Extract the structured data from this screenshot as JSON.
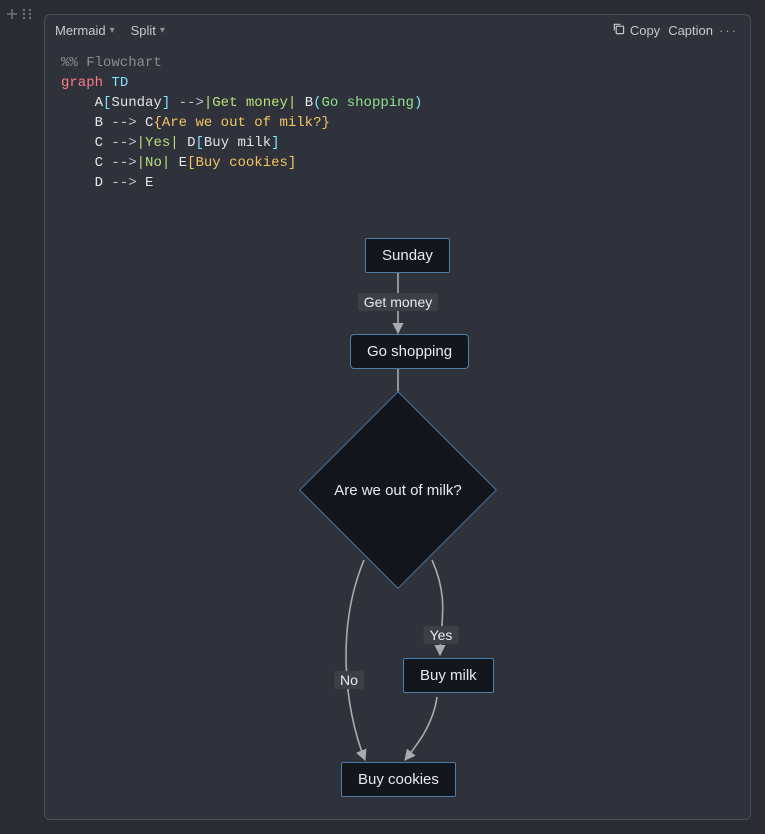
{
  "toolbar": {
    "lang_label": "Mermaid",
    "view_label": "Split",
    "copy_label": "Copy",
    "caption_label": "Caption",
    "more_label": "···"
  },
  "code": {
    "comment": "%% Flowchart",
    "graph_kw": "graph",
    "direction": "TD",
    "l1": {
      "a": "A",
      "sunday": "Sunday",
      "arrow": "-->",
      "label": "Get money",
      "b": "B",
      "goshop": "Go shopping"
    },
    "l2": {
      "b": "B",
      "arrow": "-->",
      "c": "C",
      "text": "Are we out of milk?"
    },
    "l3": {
      "c": "C",
      "arrow": "-->",
      "label": "Yes",
      "d": "D",
      "text": "Buy milk"
    },
    "l4": {
      "c": "C",
      "arrow": "-->",
      "label": "No",
      "e": "E",
      "text": "Buy cookies"
    },
    "l5": {
      "d": "D",
      "arrow": "-->",
      "e": "E"
    }
  },
  "diagram": {
    "nodes": {
      "A": "Sunday",
      "B": "Go shopping",
      "C": "Are we out of milk?",
      "D": "Buy milk",
      "E": "Buy cookies"
    },
    "edge_labels": {
      "getmoney": "Get money",
      "yes": "Yes",
      "no": "No"
    }
  }
}
